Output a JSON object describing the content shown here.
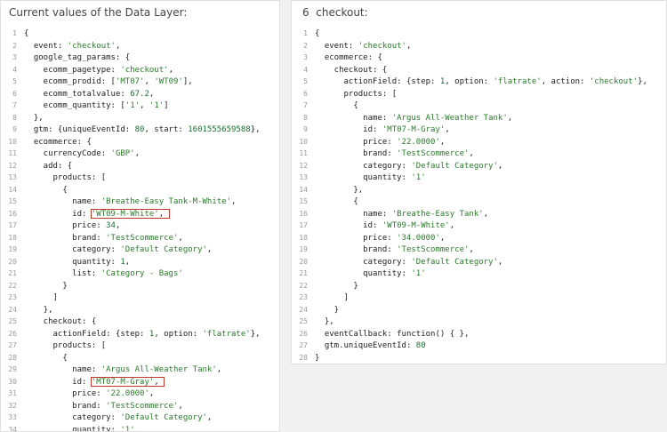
{
  "left_panel": {
    "title": "Current values of the Data Layer:",
    "lines": [
      "{",
      "  event: 'checkout',",
      "  google_tag_params: {",
      "    ecomm_pagetype: 'checkout',",
      "    ecomm_prodid: ['MT07', 'WT09'],",
      "    ecomm_totalvalue: 67.2,",
      "    ecomm_quantity: ['1', '1']",
      "  },",
      "  gtm: {uniqueEventId: 80, start: 1601555659588},",
      "  ecommerce: {",
      "    currencyCode: 'GBP',",
      "    add: {",
      "      products: [",
      "        {",
      "          name: 'Breathe-Easy Tank-M-White',",
      "          id: 'WT09-M-White',",
      "          price: 34,",
      "          brand: 'TestScommerce',",
      "          category: 'Default Category',",
      "          quantity: 1,",
      "          list: 'Category - Bags'",
      "        }",
      "      ]",
      "    },",
      "    checkout: {",
      "      actionField: {step: 1, option: 'flatrate'},",
      "      products: [",
      "        {",
      "          name: 'Argus All-Weather Tank',",
      "          id: 'MT07-M-Gray',",
      "          price: '22.0000',",
      "          brand: 'TestScommerce',",
      "          category: 'Default Category',",
      "          quantity: '1'"
    ]
  },
  "right_panel": {
    "number": "6",
    "title": "checkout:",
    "lines": [
      "{",
      "  event: 'checkout',",
      "  ecommerce: {",
      "    checkout: {",
      "      actionField: {step: 1, option: 'flatrate', action: 'checkout'},",
      "      products: [",
      "        {",
      "          name: 'Argus All-Weather Tank',",
      "          id: 'MT07-M-Gray',",
      "          price: '22.0000',",
      "          brand: 'TestScommerce',",
      "          category: 'Default Category',",
      "          quantity: '1'",
      "        },",
      "        {",
      "          name: 'Breathe-Easy Tank',",
      "          id: 'WT09-M-White',",
      "          price: '34.0000',",
      "          brand: 'TestScommerce',",
      "          category: 'Default Category',",
      "          quantity: '1'",
      "        }",
      "      ]",
      "    }",
      "  },",
      "  eventCallback: function() { },",
      "  gtm.uniqueEventId: 80",
      "}"
    ]
  },
  "highlight_color": "#c0392b"
}
